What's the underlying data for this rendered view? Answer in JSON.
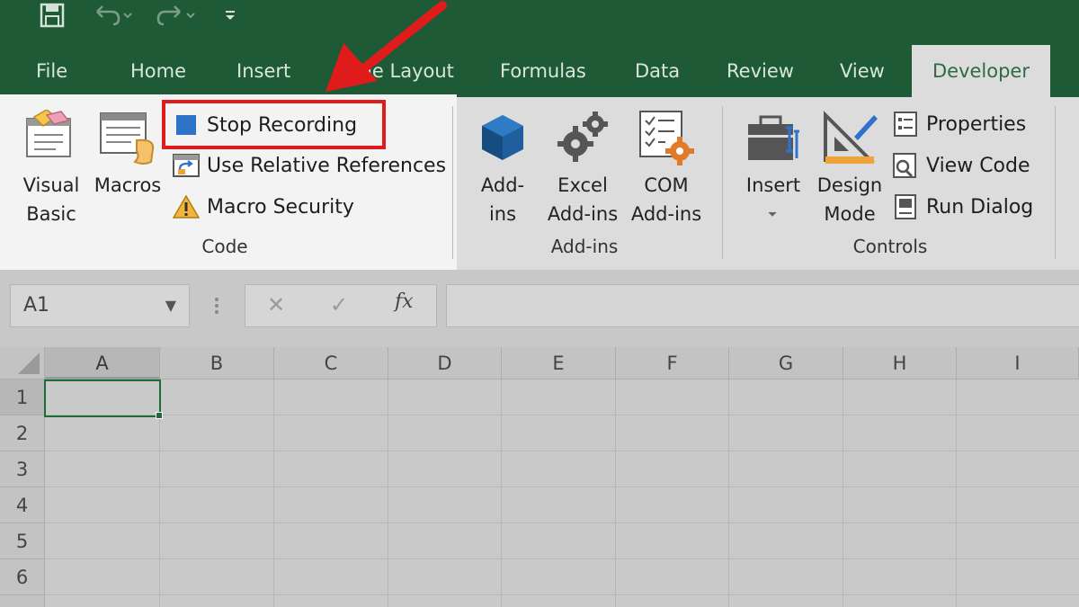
{
  "quick_access": {
    "icons": [
      "save-icon",
      "undo-icon",
      "redo-icon",
      "customize-qat-icon"
    ]
  },
  "tabs": [
    {
      "label": "File",
      "active": false
    },
    {
      "label": "Home",
      "active": false
    },
    {
      "label": "Insert",
      "active": false
    },
    {
      "label": "Page Layout",
      "active": false
    },
    {
      "label": "Formulas",
      "active": false
    },
    {
      "label": "Data",
      "active": false
    },
    {
      "label": "Review",
      "active": false
    },
    {
      "label": "View",
      "active": false
    },
    {
      "label": "Developer",
      "active": true
    }
  ],
  "ribbon": {
    "code": {
      "group_label": "Code",
      "visual_basic": {
        "line1": "Visual",
        "line2": "Basic"
      },
      "macros": "Macros",
      "stop_recording": "Stop Recording",
      "use_relative_references": "Use Relative References",
      "macro_security": "Macro Security"
    },
    "addins": {
      "group_label": "Add-ins",
      "addins": {
        "line1": "Add-",
        "line2": "ins"
      },
      "excel_addins": {
        "line1": "Excel",
        "line2": "Add-ins"
      },
      "com_addins": {
        "line1": "COM",
        "line2": "Add-ins"
      }
    },
    "controls": {
      "group_label": "Controls",
      "insert": "Insert",
      "design_mode": {
        "line1": "Design",
        "line2": "Mode"
      },
      "properties": "Properties",
      "view_code": "View Code",
      "run_dialog": "Run Dialog"
    }
  },
  "formula_bar": {
    "name_box": "A1",
    "cancel_symbol": "✕",
    "enter_symbol": "✓",
    "fx_label": "fx"
  },
  "grid": {
    "columns": [
      "A",
      "B",
      "C",
      "D",
      "E",
      "F",
      "G",
      "H",
      "I"
    ],
    "rows": [
      "1",
      "2",
      "3",
      "4",
      "5",
      "6"
    ],
    "active_cell": "A1"
  },
  "colors": {
    "title_bar": "#1e5a36",
    "highlight_box": "#e01b1b",
    "arrow": "#e01b1b"
  }
}
